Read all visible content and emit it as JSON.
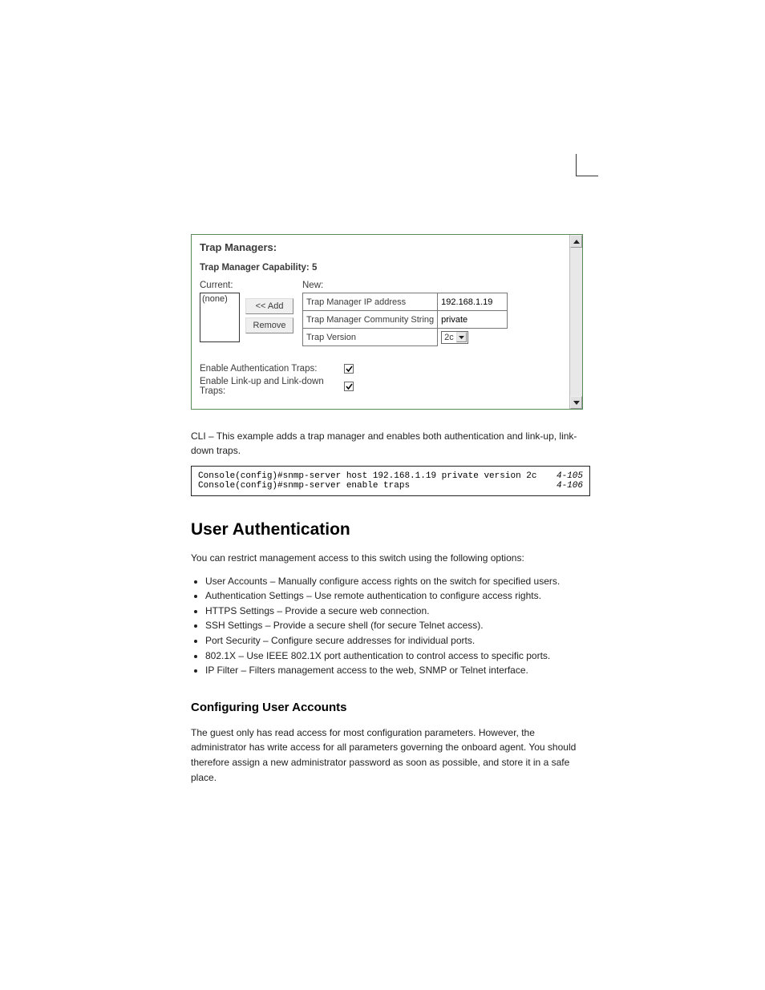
{
  "screenshot": {
    "title": "Trap Managers:",
    "capability_label": "Trap Manager Capability: 5",
    "current_label": "Current:",
    "current_list": "(none)",
    "add_button": "<< Add",
    "remove_button": "Remove",
    "new_label": "New:",
    "fields": {
      "ip_label": "Trap Manager IP address",
      "ip_value": "192.168.1.19",
      "community_label": "Trap Manager Community String",
      "community_value": "private",
      "version_label": "Trap Version",
      "version_value": "2c"
    },
    "traps": {
      "auth_label": "Enable Authentication Traps:",
      "link_label": "Enable Link-up and Link-down Traps:"
    }
  },
  "cli_intro": "CLI – This example adds a trap manager and enables both authentication and link-up, link-down traps.",
  "cli": {
    "line1_cmd": "Console(config)#snmp-server host 192.168.1.19 private version 2c",
    "line1_ref": "4-105",
    "line2_cmd": "Console(config)#snmp-server enable traps",
    "line2_ref": "4-106"
  },
  "section": {
    "h1": "User Authentication",
    "p1": "You can restrict management access to this switch using the following options:",
    "bullets": {
      "b1": "User Accounts – Manually configure access rights on the switch for specified users.",
      "b2": "Authentication Settings – Use remote authentication to configure access rights.",
      "b3": "HTTPS Settings – Provide a secure web connection.",
      "b4": "SSH Settings – Provide a secure shell (for secure Telnet access).",
      "b5": "Port Security – Configure secure addresses for individual ports.",
      "b6": "802.1X – Use IEEE 802.1X port authentication to control access to specific ports.",
      "b7": "IP Filter – Filters management access to the web, SNMP or Telnet interface."
    },
    "h2": "Configuring User Accounts",
    "p2": "The guest only has read access for most configuration parameters. However, the administrator has write access for all parameters governing the onboard agent. You should therefore assign a new administrator password as soon as possible, and store it in a safe place."
  }
}
